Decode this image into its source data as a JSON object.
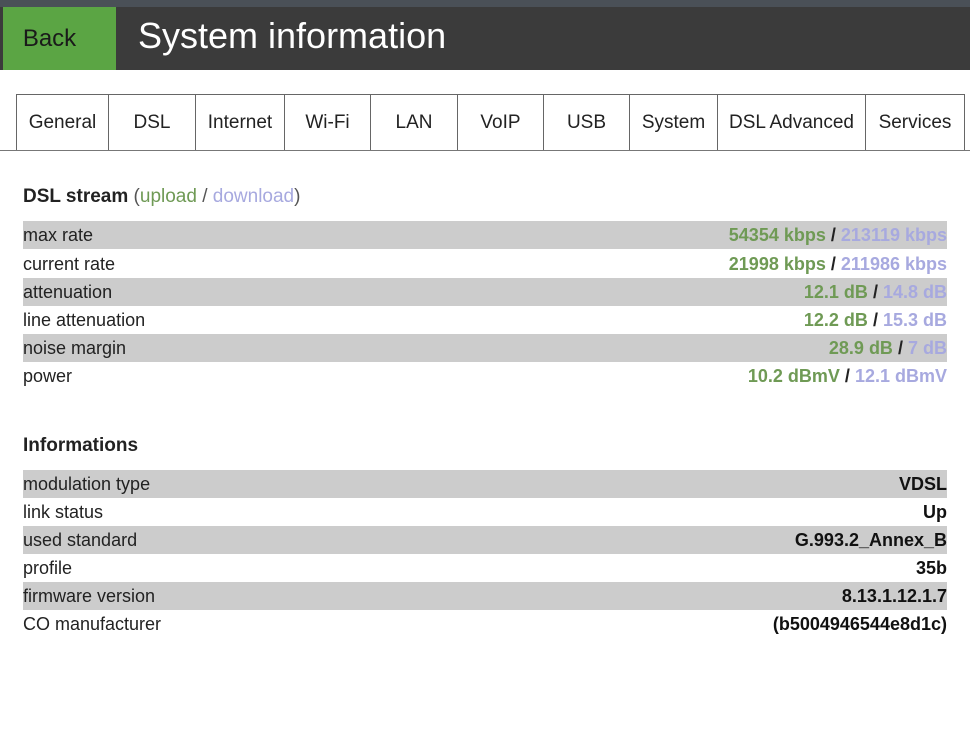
{
  "header": {
    "back_label": "Back",
    "title": "System information"
  },
  "tabs": [
    {
      "label": "General"
    },
    {
      "label": "DSL"
    },
    {
      "label": "Internet"
    },
    {
      "label": "Wi-Fi"
    },
    {
      "label": "LAN"
    },
    {
      "label": "VoIP"
    },
    {
      "label": "USB"
    },
    {
      "label": "System"
    },
    {
      "label": "DSL Advanced"
    },
    {
      "label": "Services"
    }
  ],
  "dsl_stream": {
    "title": "DSL stream",
    "paren_open": "(",
    "upload_label": "upload",
    "slash": "/",
    "download_label": "download",
    "paren_close": ")",
    "rows": [
      {
        "label": "max rate",
        "up": "54354 kbps",
        "sep": "/",
        "down": "213119 kbps"
      },
      {
        "label": "current rate",
        "up": "21998 kbps",
        "sep": "/",
        "down": "211986 kbps"
      },
      {
        "label": "attenuation",
        "up": "12.1 dB",
        "sep": "/",
        "down": "14.8 dB"
      },
      {
        "label": "line attenuation",
        "up": "12.2 dB",
        "sep": "/",
        "down": "15.3 dB"
      },
      {
        "label": "noise margin",
        "up": "28.9 dB",
        "sep": "/",
        "down": "7 dB"
      },
      {
        "label": "power",
        "up": "10.2 dBmV",
        "sep": "/",
        "down": "12.1 dBmV"
      }
    ]
  },
  "informations": {
    "title": "Informations",
    "rows": [
      {
        "label": "modulation type",
        "value": "VDSL"
      },
      {
        "label": "link status",
        "value": "Up"
      },
      {
        "label": "used standard",
        "value": "G.993.2_Annex_B"
      },
      {
        "label": "profile",
        "value": "35b"
      },
      {
        "label": "firmware version",
        "value": "8.13.1.12.1.7"
      },
      {
        "label": "CO manufacturer",
        "value": "(b5004946544e8d1c)"
      }
    ]
  },
  "colors": {
    "header_bg": "#3b3b3b",
    "back_bg": "#5ba544",
    "upload": "#6f9a55",
    "download": "#a7a9df",
    "row_shade": "#cccccc"
  }
}
